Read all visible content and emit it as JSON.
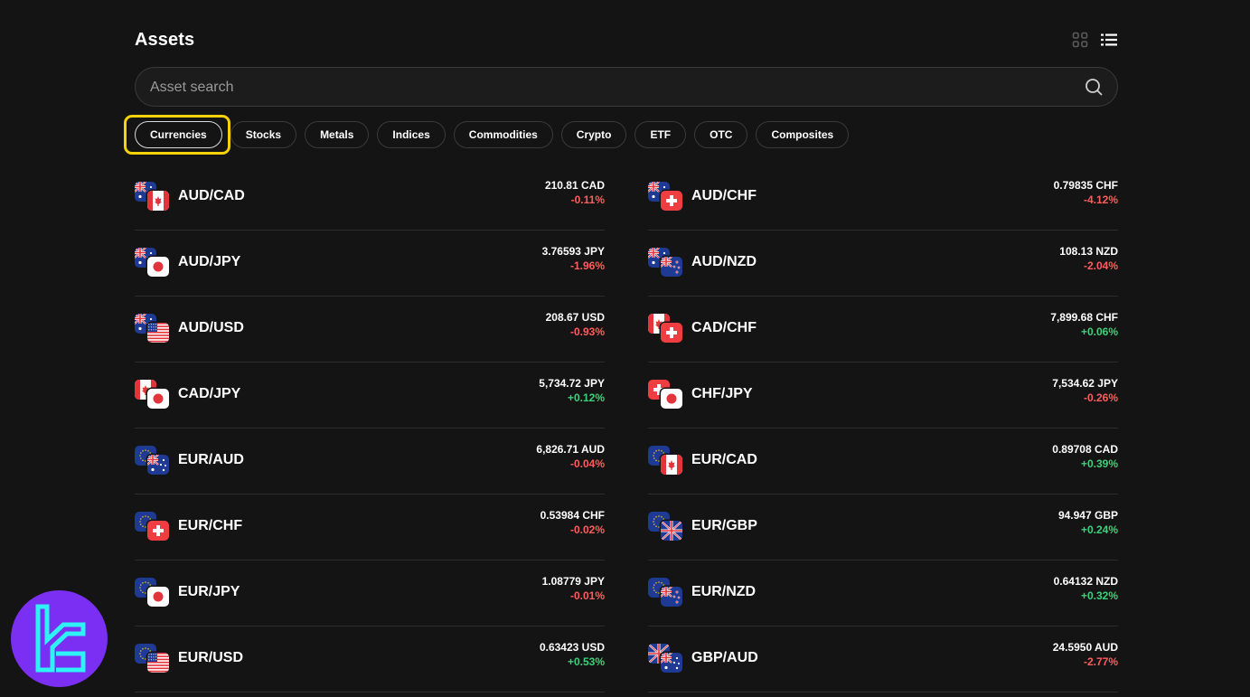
{
  "header": {
    "title": "Assets"
  },
  "search": {
    "placeholder": "Asset search"
  },
  "tabs": [
    {
      "label": "Currencies",
      "active": true
    },
    {
      "label": "Stocks"
    },
    {
      "label": "Metals"
    },
    {
      "label": "Indices"
    },
    {
      "label": "Commodities"
    },
    {
      "label": "Crypto"
    },
    {
      "label": "ETF"
    },
    {
      "label": "OTC"
    },
    {
      "label": "Composites"
    }
  ],
  "colors": {
    "accent_highlight": "#f5d20a",
    "positive": "#3ed07a",
    "negative": "#ff5c5c",
    "background": "#141414"
  },
  "assets": [
    {
      "symbol": "AUD/CAD",
      "base": "AUD",
      "quote": "CAD",
      "price": "210.81 CAD",
      "change": "-0.11%"
    },
    {
      "symbol": "AUD/CHF",
      "base": "AUD",
      "quote": "CHF",
      "price": "0.79835 CHF",
      "change": "-4.12%"
    },
    {
      "symbol": "AUD/JPY",
      "base": "AUD",
      "quote": "JPY",
      "price": "3.76593 JPY",
      "change": "-1.96%"
    },
    {
      "symbol": "AUD/NZD",
      "base": "AUD",
      "quote": "NZD",
      "price": "108.13 NZD",
      "change": "-2.04%"
    },
    {
      "symbol": "AUD/USD",
      "base": "AUD",
      "quote": "USD",
      "price": "208.67 USD",
      "change": "-0.93%"
    },
    {
      "symbol": "CAD/CHF",
      "base": "CAD",
      "quote": "CHF",
      "price": "7,899.68 CHF",
      "change": "+0.06%"
    },
    {
      "symbol": "CAD/JPY",
      "base": "CAD",
      "quote": "JPY",
      "price": "5,734.72 JPY",
      "change": "+0.12%"
    },
    {
      "symbol": "CHF/JPY",
      "base": "CHF",
      "quote": "JPY",
      "price": "7,534.62 JPY",
      "change": "-0.26%"
    },
    {
      "symbol": "EUR/AUD",
      "base": "EUR",
      "quote": "AUD",
      "price": "6,826.71 AUD",
      "change": "-0.04%"
    },
    {
      "symbol": "EUR/CAD",
      "base": "EUR",
      "quote": "CAD",
      "price": "0.89708 CAD",
      "change": "+0.39%"
    },
    {
      "symbol": "EUR/CHF",
      "base": "EUR",
      "quote": "CHF",
      "price": "0.53984 CHF",
      "change": "-0.02%"
    },
    {
      "symbol": "EUR/GBP",
      "base": "EUR",
      "quote": "GBP",
      "price": "94.947 GBP",
      "change": "+0.24%"
    },
    {
      "symbol": "EUR/JPY",
      "base": "EUR",
      "quote": "JPY",
      "price": "1.08779 JPY",
      "change": "-0.01%"
    },
    {
      "symbol": "EUR/NZD",
      "base": "EUR",
      "quote": "NZD",
      "price": "0.64132 NZD",
      "change": "+0.32%"
    },
    {
      "symbol": "EUR/USD",
      "base": "EUR",
      "quote": "USD",
      "price": "0.63423 USD",
      "change": "+0.53%"
    },
    {
      "symbol": "GBP/AUD",
      "base": "GBP",
      "quote": "AUD",
      "price": "24.5950 AUD",
      "change": "-2.77%"
    }
  ]
}
